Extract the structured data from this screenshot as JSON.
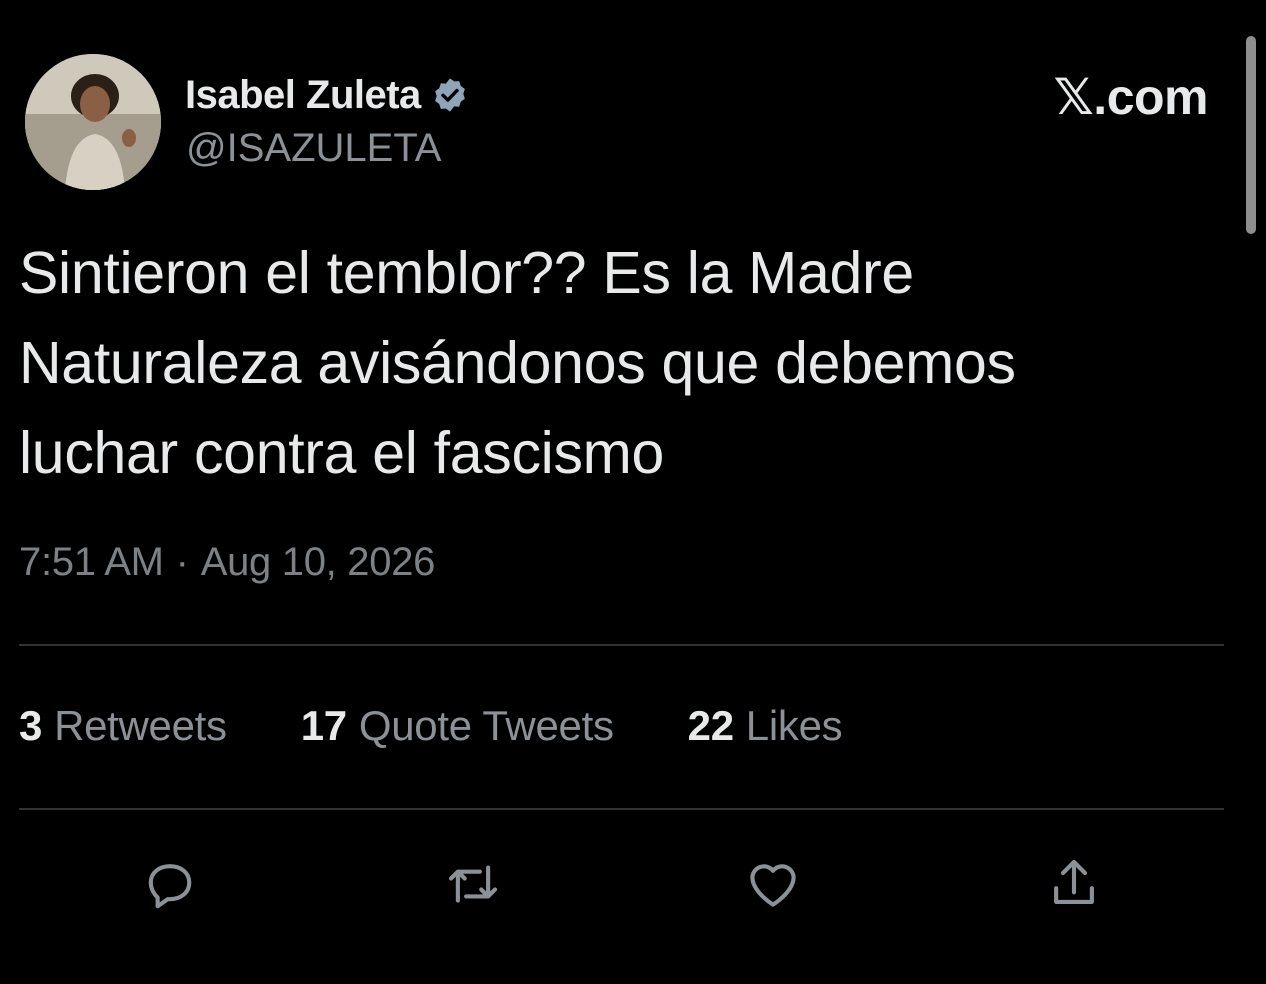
{
  "header": {
    "display_name": "Isabel Zuleta",
    "handle": "@ISAZULETA",
    "brand": "𝕏.com",
    "avatar_icon": "profile-photo",
    "verified_icon": "verified-badge-icon",
    "verified_color": "#8ea4b8"
  },
  "tweet": {
    "text_line1": "Sintieron el temblor?? Es la Madre",
    "text_line2": "Naturaleza avisándonos que debemos",
    "text_line3": "luchar contra el fascismo",
    "time": "7:51 AM",
    "separator": "·",
    "date": "Aug 10, 2026"
  },
  "stats": {
    "retweets_count": "3",
    "retweets_label": "Retweets",
    "quotes_count": "17",
    "quotes_label": "Quote Tweets",
    "likes_count": "22",
    "likes_label": "Likes"
  },
  "actions": [
    {
      "icon": "reply-icon"
    },
    {
      "icon": "retweet-icon"
    },
    {
      "icon": "like-icon"
    },
    {
      "icon": "share-icon"
    }
  ],
  "colors": {
    "background": "#000000",
    "primary_text": "#e7e9ea",
    "secondary_text": "#8b9196",
    "divider": "#2f3336",
    "icon": "#8b9196"
  }
}
